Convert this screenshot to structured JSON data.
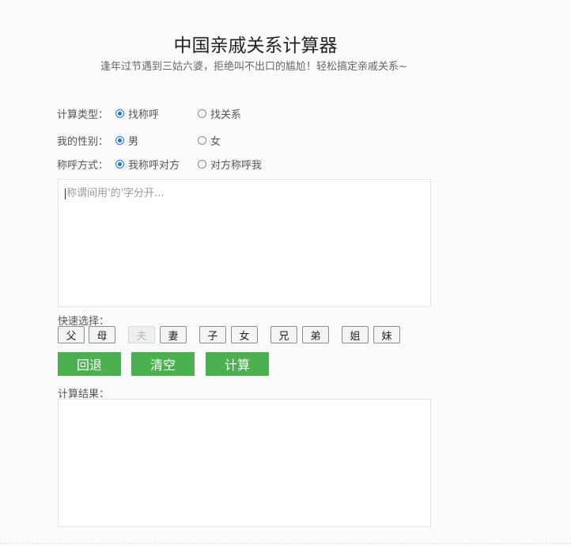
{
  "header": {
    "title": "中国亲戚关系计算器",
    "subtitle": "逢年过节遇到三姑六婆，拒绝叫不出口的尴尬！轻松搞定亲戚关系~"
  },
  "options": {
    "type": {
      "label": "计算类型：",
      "choices": [
        "找称呼",
        "找关系"
      ],
      "selected": 0
    },
    "gender": {
      "label": "我的性别：",
      "choices": [
        "男",
        "女"
      ],
      "selected": 0
    },
    "mode": {
      "label": "称呼方式：",
      "choices": [
        "我称呼对方",
        "对方称呼我"
      ],
      "selected": 0
    }
  },
  "input": {
    "value": "",
    "placeholder": "称谓间用'的'字分开..."
  },
  "quick": {
    "label": "快速选择：",
    "buttons": [
      {
        "text": "父",
        "disabled": false
      },
      {
        "text": "母",
        "disabled": false
      },
      {
        "text": "夫",
        "disabled": true
      },
      {
        "text": "妻",
        "disabled": false
      },
      {
        "text": "子",
        "disabled": false
      },
      {
        "text": "女",
        "disabled": false
      },
      {
        "text": "兄",
        "disabled": false
      },
      {
        "text": "弟",
        "disabled": false
      },
      {
        "text": "姐",
        "disabled": false
      },
      {
        "text": "妹",
        "disabled": false
      }
    ]
  },
  "actions": {
    "back": "回退",
    "clear": "清空",
    "calc": "计算"
  },
  "result": {
    "label": "计算结果：",
    "value": ""
  },
  "colors": {
    "accent": "#4caf50",
    "radio": "#1a73e8"
  }
}
